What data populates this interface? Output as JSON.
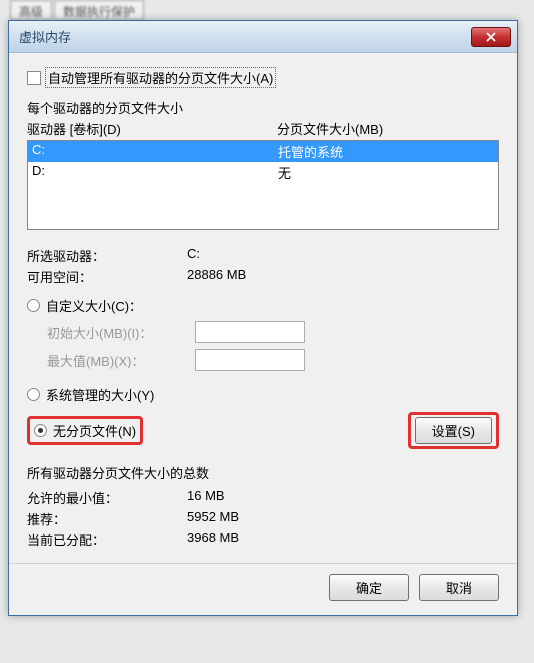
{
  "bg_tabs": [
    "高级",
    "数据执行保护"
  ],
  "dialog": {
    "title": "虚拟内存",
    "auto_manage_label": "自动管理所有驱动器的分页文件大小(A)",
    "per_drive_label": "每个驱动器的分页文件大小",
    "col_drive": "驱动器 [卷标](D)",
    "col_size": "分页文件大小(MB)",
    "drives": [
      {
        "name": "C:",
        "status": "托管的系统",
        "selected": true
      },
      {
        "name": "D:",
        "status": "无",
        "selected": false
      }
    ],
    "selected_drive_label": "所选驱动器：",
    "selected_drive_value": "C:",
    "free_space_label": "可用空间：",
    "free_space_value": "28886 MB",
    "radio_custom": "自定义大小(C)：",
    "initial_label": "初始大小(MB)(I)：",
    "max_label": "最大值(MB)(X)：",
    "radio_system": "系统管理的大小(Y)",
    "radio_none": "无分页文件(N)",
    "set_button": "设置(S)",
    "totals_label": "所有驱动器分页文件大小的总数",
    "min_allowed_label": "允许的最小值：",
    "min_allowed_value": "16 MB",
    "recommended_label": "推荐：",
    "recommended_value": "5952 MB",
    "current_label": "当前已分配：",
    "current_value": "3968 MB",
    "ok": "确定",
    "cancel": "取消"
  }
}
